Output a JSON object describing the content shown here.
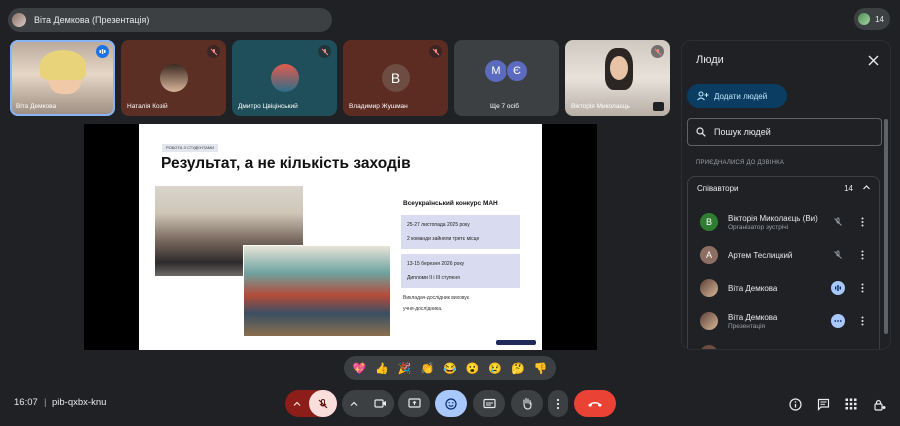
{
  "meeting": {
    "presenter_title": "Віта Демкова (Презентація)",
    "participant_count": "14",
    "time": "16:07",
    "separator": "|",
    "code": "pib-qxbx-knu"
  },
  "tiles": [
    {
      "name": "Віта Демкова",
      "status": "speaking"
    },
    {
      "name": "Наталія Козій",
      "status": "muted"
    },
    {
      "name": "Дмитро Цвіцінський",
      "status": "muted"
    },
    {
      "name": "Владимир Жушман",
      "status": "muted",
      "initial": "В"
    },
    {
      "name": "Ще 7 осіб",
      "initials": [
        "М",
        "Є"
      ]
    },
    {
      "name": "Вікторія Миколаєць",
      "status": "muted"
    }
  ],
  "slide": {
    "tag": "РОБОТА З СТУДЕНТАМИ",
    "heading": "Результат, а не кількість заходів",
    "competition_title": "Всеукраїнський конкурс МАН",
    "box1_line1": "25-27 листопада 2025 року",
    "box1_line2": "2 команди зайняли третє місце",
    "box2_line1": "13-15 березня 2026 року",
    "box2_line2": "Дипломи ІІ і ІІІ ступеня",
    "note_line1": "Викладач-дослідник виховує",
    "note_line2": "учня-дослідника."
  },
  "reactions": [
    "💖",
    "👍",
    "🎉",
    "👏",
    "😂",
    "😮",
    "😢",
    "🤔",
    "👎"
  ],
  "panel": {
    "title": "Люди",
    "add_people": "Додати людей",
    "search_placeholder": "Пошук людей",
    "section_label": "ПРИЄДНАЛИСЯ ДО ДЗВІНКА",
    "group_label": "Співавтори",
    "group_count": "14",
    "people": [
      {
        "name": "Вікторія Миколаєць (Ви)",
        "sub": "Організатор зустрічі",
        "initial": "В",
        "color": "#2e7d32"
      },
      {
        "name": "Артем Теслицкий",
        "sub": "",
        "initial": "А",
        "color": "#8d6e63"
      },
      {
        "name": "Віта Демкова",
        "sub": "",
        "initial": "",
        "color": "#6d4c41"
      },
      {
        "name": "Віта Демкова",
        "sub": "Презентація",
        "initial": "",
        "color": "#6d4c41"
      }
    ]
  },
  "colors": {
    "background": "#202124",
    "surface": "#3c4043",
    "accent_blue": "#8ab4f8",
    "end_call_red": "#ea4335"
  }
}
